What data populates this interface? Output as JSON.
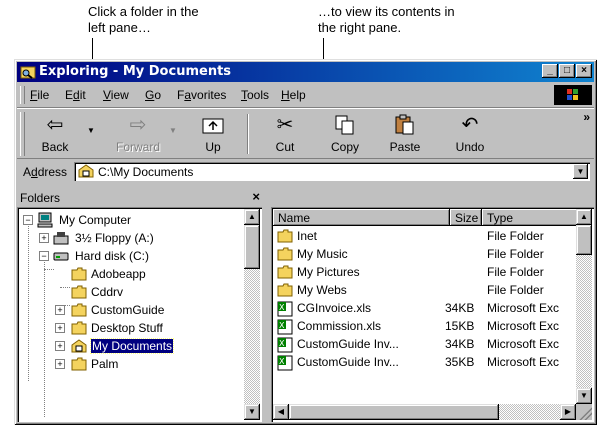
{
  "callouts": {
    "left": [
      "Click a folder in the",
      "left pane…"
    ],
    "right": [
      "…to view its contents in",
      "the right pane."
    ]
  },
  "window": {
    "title": "Exploring - My Documents",
    "buttons": {
      "minimize": "_",
      "maximize": "□",
      "close": "×"
    }
  },
  "menu": [
    "File",
    "Edit",
    "View",
    "Go",
    "Favorites",
    "Tools",
    "Help"
  ],
  "menu_hotkeys": [
    "F",
    "d",
    "V",
    "G",
    "a",
    "T",
    "H"
  ],
  "toolbar": {
    "back": "Back",
    "forward": "Forward",
    "up": "Up",
    "cut": "Cut",
    "copy": "Copy",
    "paste": "Paste",
    "undo": "Undo",
    "more": "»"
  },
  "address": {
    "label": "Address",
    "value": "C:\\My Documents"
  },
  "folders_pane": {
    "title": "Folders",
    "close": "×",
    "tree": [
      {
        "label": "My Computer",
        "expander": "−",
        "icon": "computer-icon"
      },
      {
        "label": "3½ Floppy (A:)",
        "expander": "+",
        "icon": "floppy-icon"
      },
      {
        "label": "Hard disk (C:)",
        "expander": "−",
        "icon": "harddisk-icon"
      },
      {
        "label": "Adobeapp",
        "expander": "",
        "icon": "folder-icon"
      },
      {
        "label": "Cddrv",
        "expander": "",
        "icon": "folder-icon"
      },
      {
        "label": "CustomGuide",
        "expander": "+",
        "icon": "folder-icon"
      },
      {
        "label": "Desktop Stuff",
        "expander": "+",
        "icon": "folder-icon"
      },
      {
        "label": "My Documents",
        "expander": "+",
        "icon": "my-documents-icon",
        "selected": true
      },
      {
        "label": "Palm",
        "expander": "+",
        "icon": "folder-icon"
      }
    ]
  },
  "file_list": {
    "columns": [
      "Name",
      "Size",
      "Type"
    ],
    "rows": [
      {
        "name": "Inet",
        "size": "",
        "type": "File Folder",
        "icon": "folder-icon"
      },
      {
        "name": "My Music",
        "size": "",
        "type": "File Folder",
        "icon": "folder-icon"
      },
      {
        "name": "My Pictures",
        "size": "",
        "type": "File Folder",
        "icon": "folder-icon"
      },
      {
        "name": "My Webs",
        "size": "",
        "type": "File Folder",
        "icon": "folder-icon"
      },
      {
        "name": "CGInvoice.xls",
        "size": "34KB",
        "type": "Microsoft Exc",
        "icon": "excel-file-icon"
      },
      {
        "name": "Commission.xls",
        "size": "15KB",
        "type": "Microsoft Exc",
        "icon": "excel-file-icon"
      },
      {
        "name": "CustomGuide Inv...",
        "size": "34KB",
        "type": "Microsoft Exc",
        "icon": "excel-file-icon"
      },
      {
        "name": "CustomGuide Inv...",
        "size": "35KB",
        "type": "Microsoft Exc",
        "icon": "excel-file-icon"
      }
    ]
  },
  "colors": {
    "titlebar_start": "#000080",
    "titlebar_end": "#1084d0",
    "selection": "#000080",
    "chrome": "#c0c0c0",
    "folder": "#f4d35e"
  }
}
